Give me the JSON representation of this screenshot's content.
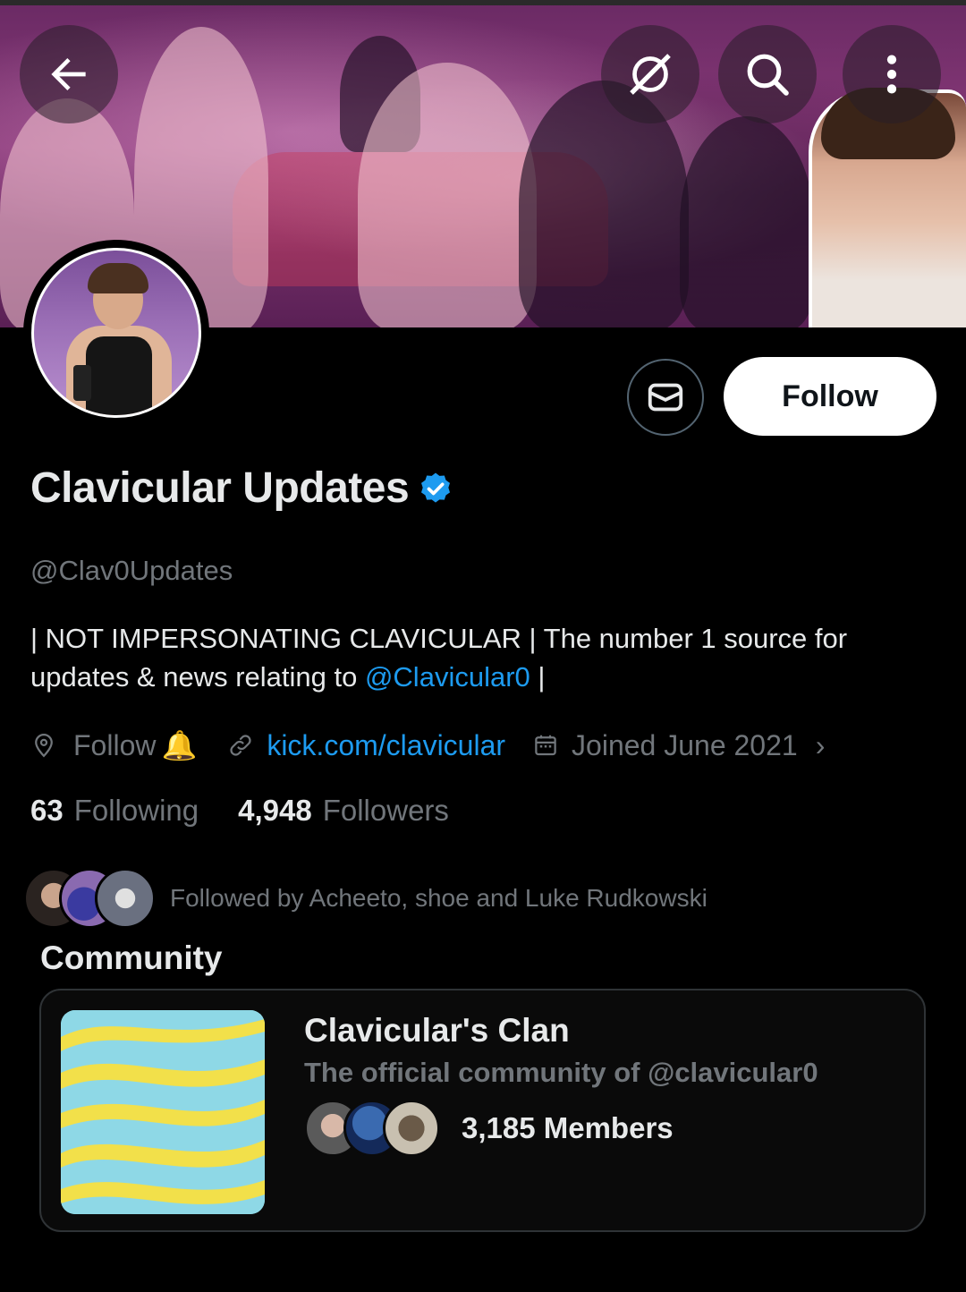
{
  "header": {
    "back_icon": "arrow-left-icon",
    "grok_icon": "grok-icon",
    "search_icon": "search-icon",
    "more_icon": "more-vertical-icon"
  },
  "profile": {
    "display_name": "Clavicular Updates",
    "handle": "@Clav0Updates",
    "verified": true,
    "follow_label": "Follow",
    "message_icon": "envelope-icon"
  },
  "bio": {
    "text_before": "| NOT IMPERSONATING CLAVICULAR | The number 1 source for updates & news relating to ",
    "mention": "@Clavicular0",
    "text_after": " |"
  },
  "meta": {
    "location": "Follow",
    "location_emoji": "🔔",
    "link": "kick.com/clavicular",
    "joined": "Joined June 2021"
  },
  "stats": {
    "following_count": "63",
    "following_label": "Following",
    "followers_count": "4,948",
    "followers_label": "Followers"
  },
  "followed_by": {
    "text": "Followed by Acheeto, shoe and Luke Rudkowski"
  },
  "community": {
    "section_title": "Community",
    "name": "Clavicular's Clan",
    "description": "The official community of @clavicular0",
    "members": "3,185 Members"
  },
  "colors": {
    "accent": "#1d9bf0",
    "muted": "#71767b",
    "background": "#000000",
    "banner_tint": "#8a3a7a"
  }
}
